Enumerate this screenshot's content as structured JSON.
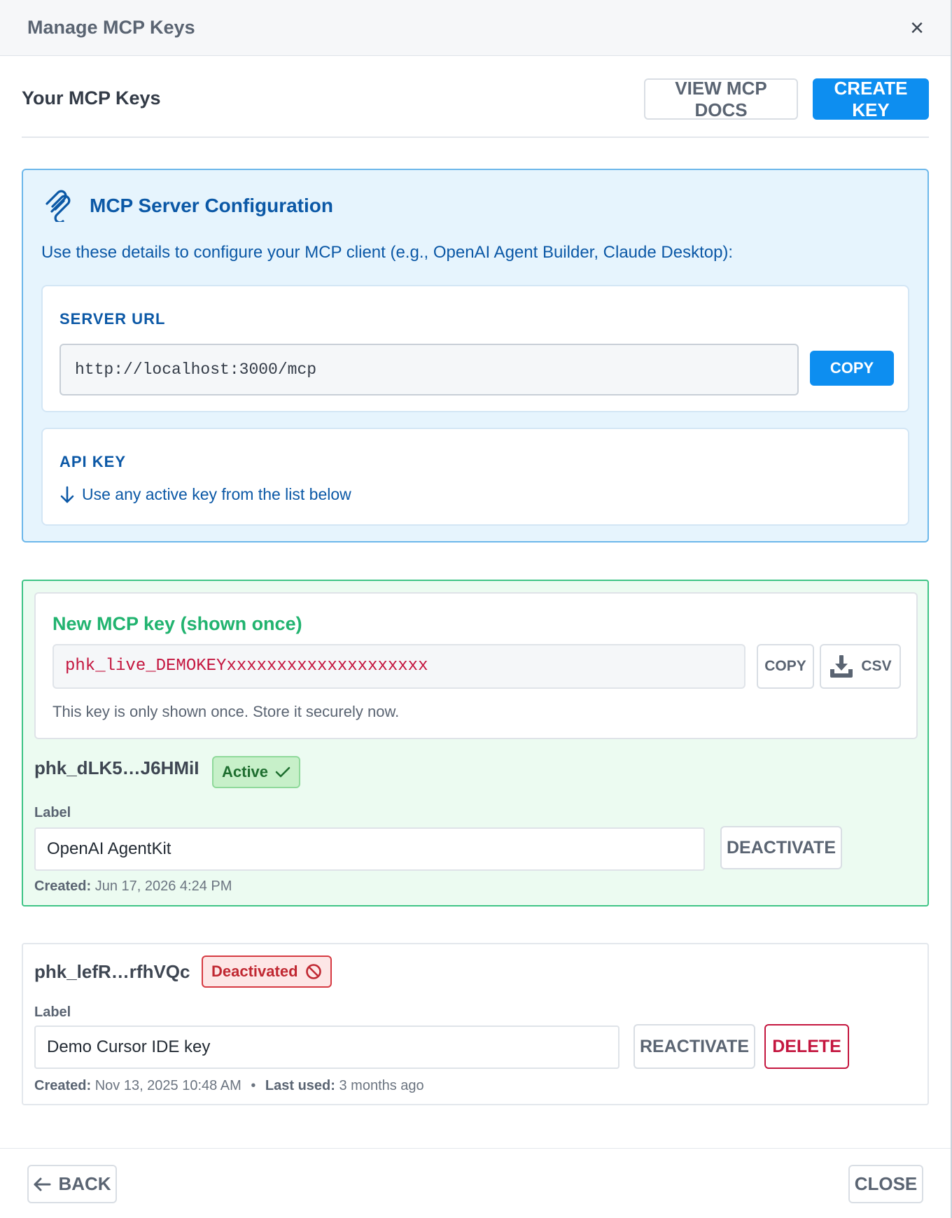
{
  "header": {
    "title": "Manage MCP Keys",
    "close_icon": "×"
  },
  "section": {
    "title": "Your MCP Keys",
    "view_docs_label": "VIEW MCP DOCS",
    "create_key_label": "CREATE KEY"
  },
  "config": {
    "icon": "mcp-plug-icon",
    "title": "MCP Server Configuration",
    "description": "Use these details to configure your MCP client (e.g., OpenAI Agent Builder, Claude Desktop):",
    "server_url_label": "SERVER URL",
    "server_url_value": "http://localhost:3000/mcp",
    "copy_label": "COPY",
    "api_key_label": "API KEY",
    "api_key_hint": "Use any active key from the list below"
  },
  "new_key": {
    "title": "New MCP key (shown once)",
    "value": "phk_live_DEMOKEYxxxxxxxxxxxxxxxxxxxx",
    "copy_label": "COPY",
    "csv_label": "CSV",
    "note": "This key is only shown once. Store it securely now."
  },
  "keys": [
    {
      "id": "phk_dLK5…J6HMiI",
      "status": "Active",
      "label_caption": "Label",
      "label_value": "OpenAI AgentKit",
      "action_label": "DEACTIVATE",
      "created_caption": "Created:",
      "created_value": "Jun 17, 2026 4:24 PM"
    },
    {
      "id": "phk_lefR…rfhVQc",
      "status": "Deactivated",
      "label_caption": "Label",
      "label_value": "Demo Cursor IDE key",
      "action_label": "REACTIVATE",
      "delete_label": "DELETE",
      "created_caption": "Created:",
      "created_value": "Nov 13, 2025 10:48 AM",
      "separator": "•",
      "last_used_caption": "Last used:",
      "last_used_value": "3 months ago"
    }
  ],
  "footer": {
    "back_label": "BACK",
    "close_label": "CLOSE"
  },
  "colors": {
    "primary": "#0d8ef0",
    "config_text": "#0b58a6",
    "success": "#21b36f",
    "danger": "#c4163f"
  }
}
